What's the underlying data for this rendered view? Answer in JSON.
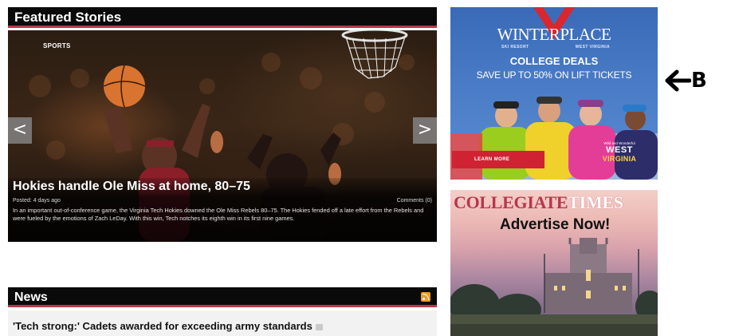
{
  "featured": {
    "header": "Featured Stories",
    "category": "SPORTS",
    "story": {
      "title": "Hokies handle Ole Miss at home, 80–75",
      "posted": "Posted: 4 days ago",
      "comments": "Comments (0)",
      "summary": "In an important out-of-conference game, the Virginia Tech Hokies downed the Ole Miss Rebels 80–75. The Hokies fended off a late effort from the Rebels and were fueled by the emotions of Zach LeDay. With this win, Tech notches its eighth win in its first nine games."
    },
    "prev_arrow": "<",
    "next_arrow": ">"
  },
  "news": {
    "header": "News",
    "items": [
      {
        "title": "'Tech strong:' Cadets awarded for exceeding army standards"
      }
    ]
  },
  "ads": {
    "winterplace": {
      "brand": "WINTERPLACE",
      "sub_left": "SKI RESORT",
      "sub_right": "WEST VIRGINIA",
      "headline": "COLLEGE DEALS",
      "offer": "SAVE UP TO 50% ON LIFT TICKETS",
      "button": "LEARN MORE",
      "wv_small": "Wild and Wonderful",
      "wv_west": "WEST",
      "wv_virginia": "VIRGINIA"
    },
    "collegiate_times": {
      "logo_part1": "COLLEGIATE",
      "logo_part2": "TIMES",
      "cta": "Advertise Now!"
    }
  },
  "annotation": {
    "label": "B"
  },
  "colors": {
    "header_bg": "#0a0a0a",
    "accent": "#b8364a",
    "ad_blue": "#4d7fc9",
    "rss_orange": "#f19a27"
  }
}
